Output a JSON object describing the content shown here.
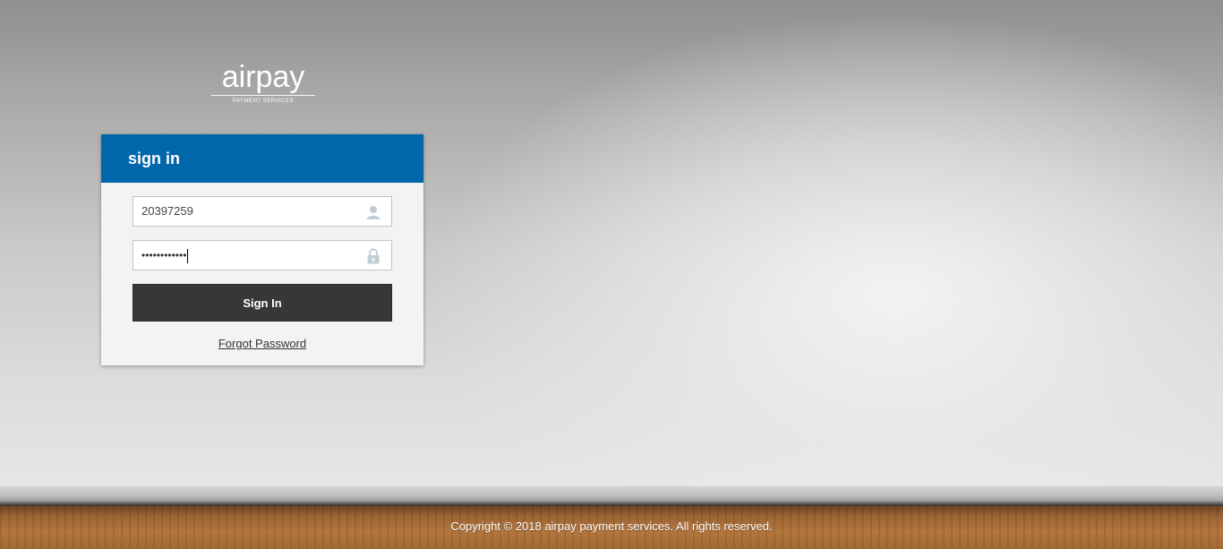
{
  "brand": {
    "logo_word": "airpay",
    "logo_subtitle": "PAYMENT SERVICES",
    "accent_color": "#0067aa"
  },
  "login": {
    "title": "sign in",
    "username": {
      "value": "20397259",
      "icon": "user-icon"
    },
    "password": {
      "masked_value": "••••••••••••",
      "icon": "lock-icon"
    },
    "submit_label": "Sign In",
    "forgot_label": "Forgot Password"
  },
  "footer": {
    "copyright": "Copyright © 2018 airpay payment services. All rights reserved."
  }
}
